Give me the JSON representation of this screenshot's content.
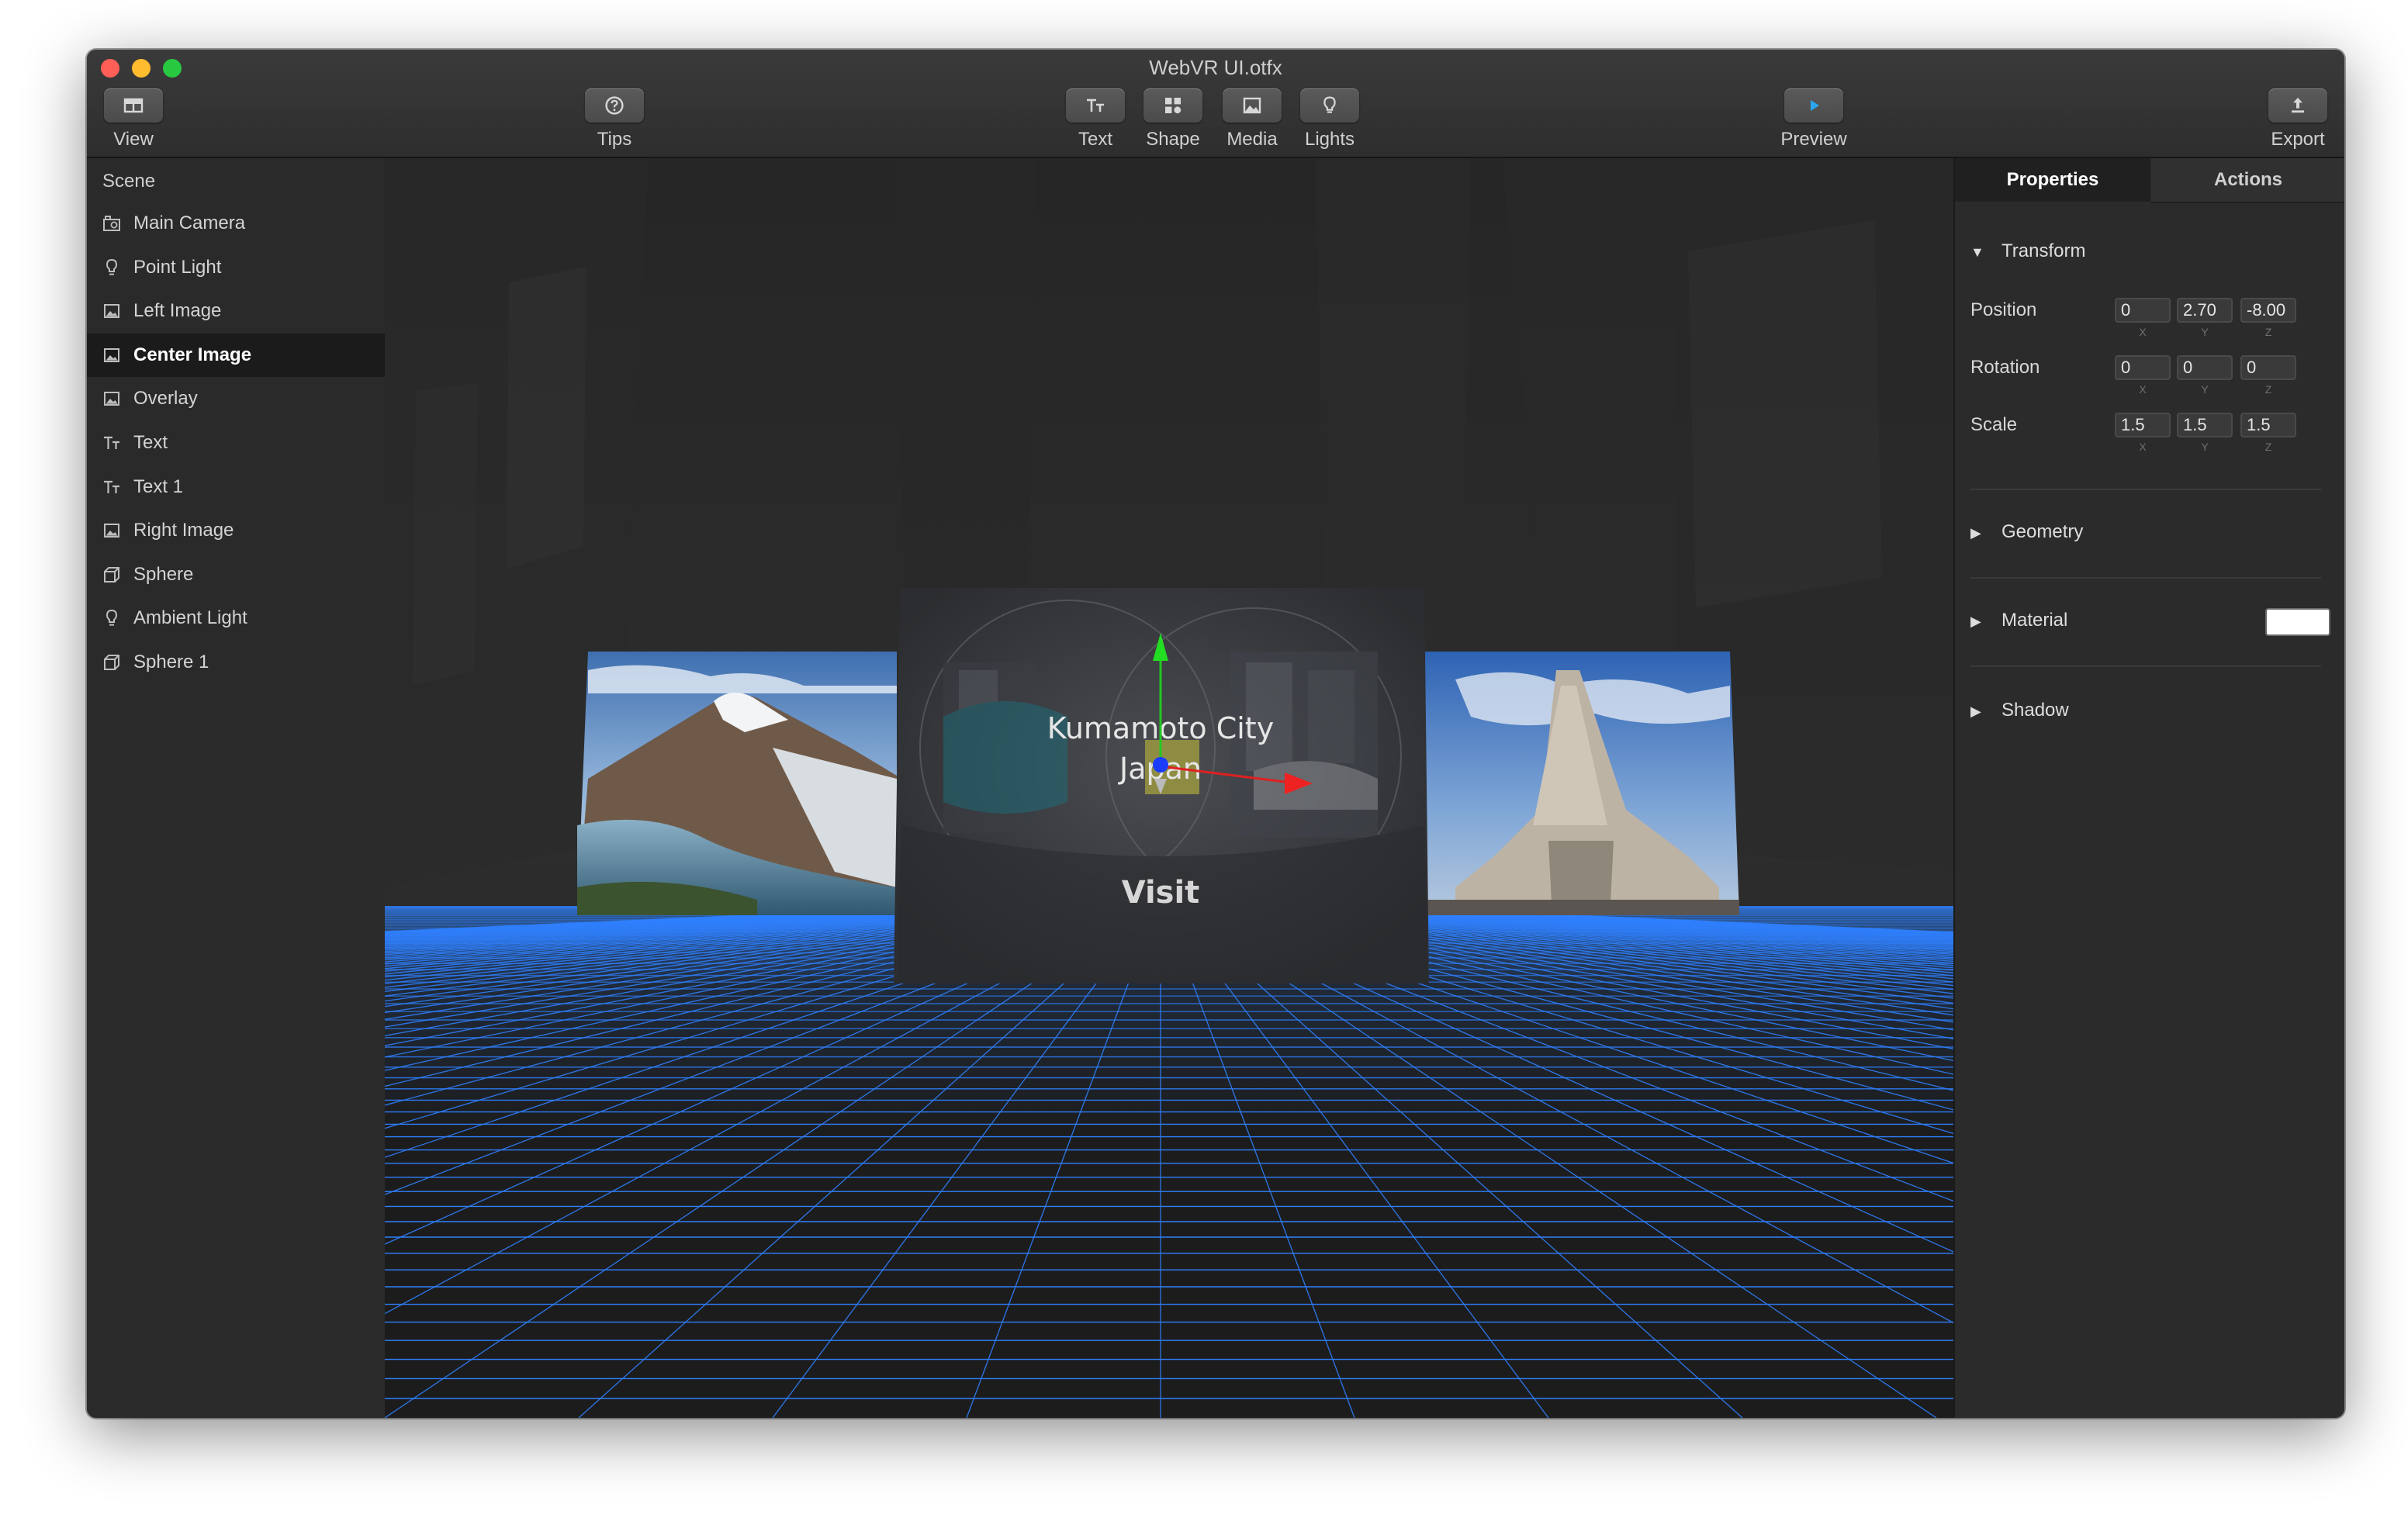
{
  "window": {
    "title": "WebVR UI.otfx"
  },
  "toolbar": {
    "view_label": "View",
    "tips_label": "Tips",
    "text_label": "Text",
    "shape_label": "Shape",
    "media_label": "Media",
    "lights_label": "Lights",
    "preview_label": "Preview",
    "export_label": "Export"
  },
  "sidebar": {
    "header": "Scene",
    "items": [
      {
        "label": "Main Camera",
        "icon": "camera-icon"
      },
      {
        "label": "Point Light",
        "icon": "lightbulb-icon"
      },
      {
        "label": "Left Image",
        "icon": "image-icon"
      },
      {
        "label": "Center Image",
        "icon": "image-icon",
        "selected": true
      },
      {
        "label": "Overlay",
        "icon": "image-icon"
      },
      {
        "label": "Text",
        "icon": "text-icon"
      },
      {
        "label": "Text 1",
        "icon": "text-icon"
      },
      {
        "label": "Right Image",
        "icon": "image-icon"
      },
      {
        "label": "Sphere",
        "icon": "cube-icon"
      },
      {
        "label": "Ambient Light",
        "icon": "lightbulb-icon"
      },
      {
        "label": "Sphere 1",
        "icon": "cube-icon"
      }
    ]
  },
  "scene": {
    "title_line1": "Kumamoto City",
    "title_line2": "Japan",
    "button_label": "Visit",
    "grid_color": "#2f80ff"
  },
  "panel": {
    "tabs": [
      "Properties",
      "Actions"
    ],
    "transform_label": "Transform",
    "position_label": "Position",
    "rotation_label": "Rotation",
    "scale_label": "Scale",
    "position": [
      "0",
      "2.70",
      "-8.00"
    ],
    "rotation": [
      "0",
      "0",
      "0"
    ],
    "scale": [
      "1.5",
      "1.5",
      "1.5"
    ],
    "axes": [
      "X",
      "Y",
      "Z"
    ],
    "geometry_label": "Geometry",
    "material_label": "Material",
    "material_color": "#ffffff",
    "shadow_label": "Shadow"
  }
}
